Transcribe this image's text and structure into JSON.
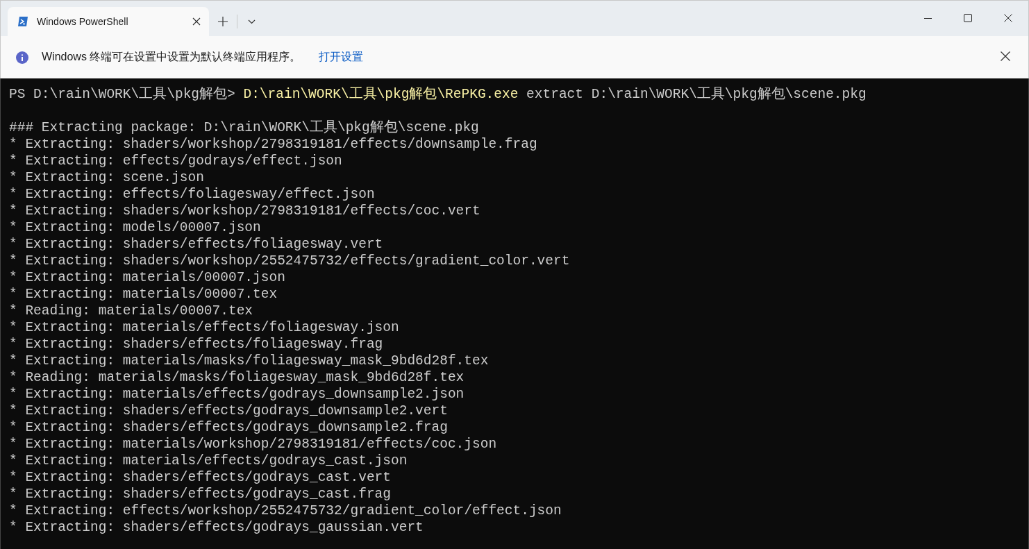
{
  "tab": {
    "title": "Windows PowerShell",
    "selected": true
  },
  "info_bar": {
    "message": "Windows 终端可在设置中设置为默认终端应用程序。",
    "link": "打开设置"
  },
  "prompt_line": {
    "prompt": "PS D:\\rain\\WORK\\工具\\pkg解包>",
    "command": "D:\\rain\\WORK\\工具\\pkg解包\\RePKG.exe",
    "arguments": "extract D:\\rain\\WORK\\工具\\pkg解包\\scene.pkg"
  },
  "output_lines": [
    "### Extracting package: D:\\rain\\WORK\\工具\\pkg解包\\scene.pkg",
    "* Extracting: shaders/workshop/2798319181/effects/downsample.frag",
    "* Extracting: effects/godrays/effect.json",
    "* Extracting: scene.json",
    "* Extracting: effects/foliagesway/effect.json",
    "* Extracting: shaders/workshop/2798319181/effects/coc.vert",
    "* Extracting: models/00007.json",
    "* Extracting: shaders/effects/foliagesway.vert",
    "* Extracting: shaders/workshop/2552475732/effects/gradient_color.vert",
    "* Extracting: materials/00007.json",
    "* Extracting: materials/00007.tex",
    "* Reading: materials/00007.tex",
    "* Extracting: materials/effects/foliagesway.json",
    "* Extracting: shaders/effects/foliagesway.frag",
    "* Extracting: materials/masks/foliagesway_mask_9bd6d28f.tex",
    "* Reading: materials/masks/foliagesway_mask_9bd6d28f.tex",
    "* Extracting: materials/effects/godrays_downsample2.json",
    "* Extracting: shaders/effects/godrays_downsample2.vert",
    "* Extracting: shaders/effects/godrays_downsample2.frag",
    "* Extracting: materials/workshop/2798319181/effects/coc.json",
    "* Extracting: materials/effects/godrays_cast.json",
    "* Extracting: shaders/effects/godrays_cast.vert",
    "* Extracting: shaders/effects/godrays_cast.frag",
    "* Extracting: effects/workshop/2552475732/gradient_color/effect.json",
    "* Extracting: shaders/effects/godrays_gaussian.vert"
  ]
}
